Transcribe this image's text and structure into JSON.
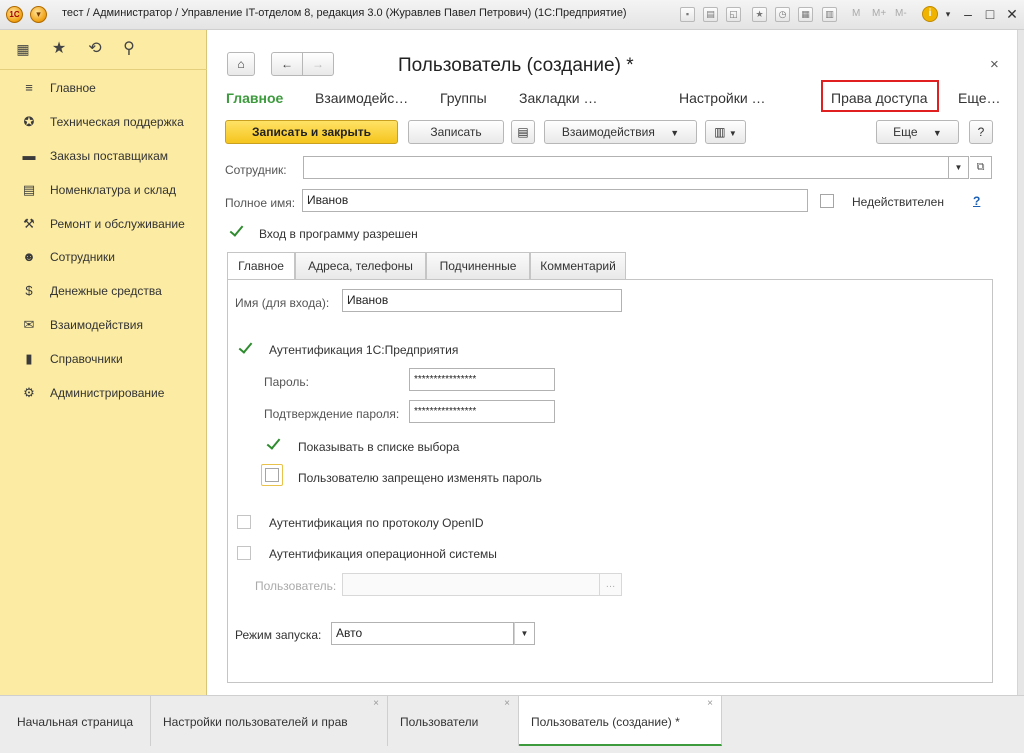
{
  "window": {
    "title": "тест / Администратор / Управление IT-отделом 8, редакция 3.0 (Журавлев Павел Петрович)  (1С:Предприятие)",
    "logo": "1С",
    "tb_m": "M",
    "tb_mplus": "M+",
    "tb_mminus": "M-"
  },
  "sidebar": {
    "items": [
      {
        "label": "Главное",
        "icon": "menu-lines-icon"
      },
      {
        "label": "Техническая поддержка",
        "icon": "support-icon"
      },
      {
        "label": "Заказы поставщикам",
        "icon": "truck-icon"
      },
      {
        "label": "Номенклатура и склад",
        "icon": "printer-icon"
      },
      {
        "label": "Ремонт и обслуживание",
        "icon": "wrench-icon"
      },
      {
        "label": "Сотрудники",
        "icon": "people-icon"
      },
      {
        "label": "Денежные средства",
        "icon": "money-bag-icon"
      },
      {
        "label": "Взаимодействия",
        "icon": "envelope-icon"
      },
      {
        "label": "Справочники",
        "icon": "book-icon"
      },
      {
        "label": "Администрирование",
        "icon": "gear-icon"
      }
    ]
  },
  "form": {
    "title": "Пользователь (создание) *",
    "close": "×",
    "tabs": [
      "Главное",
      "Взаимодейс…",
      "Группы",
      "Закладки …",
      "Настройки …",
      "Права доступа",
      "Еще…"
    ],
    "toolbar": {
      "save_close": "Записать и закрыть",
      "save": "Записать",
      "interactions": "Взаимодействия",
      "more": "Еще",
      "help": "?"
    },
    "employee_label": "Сотрудник:",
    "employee_value": "",
    "fullname_label": "Полное имя:",
    "fullname_value": "Иванов",
    "invalid_label": "Недействителен",
    "invalid_help": "?",
    "login_allowed_label": "Вход в программу разрешен",
    "subtabs": [
      "Главное",
      "Адреса, телефоны",
      "Подчиненные",
      "Комментарий"
    ],
    "login_name_label": "Имя (для входа):",
    "login_name_value": "Иванов",
    "auth_1c_label": "Аутентификация 1С:Предприятия",
    "password_label": "Пароль:",
    "password_value": "****************",
    "password_confirm_label": "Подтверждение пароля:",
    "password_confirm_value": "****************",
    "show_in_list_label": "Показывать в списке выбора",
    "forbid_change_label": "Пользователю запрещено изменять пароль",
    "openid_label": "Аутентификация по протоколу OpenID",
    "os_auth_label": "Аутентификация операционной системы",
    "os_user_label": "Пользователь:",
    "os_user_value": "",
    "startup_label": "Режим запуска:",
    "startup_value": "Авто"
  },
  "taskbar": {
    "tabs": [
      {
        "label": "Начальная страница"
      },
      {
        "label": "Настройки пользователей и прав"
      },
      {
        "label": "Пользователи"
      },
      {
        "label": "Пользователь (создание) *"
      }
    ],
    "close": "×"
  },
  "colors": {
    "sidebar_bg": "#fbeba3",
    "accent_green": "#3d9a3d",
    "primary_button": "#f5c51d",
    "highlight_red": "#e02020"
  }
}
